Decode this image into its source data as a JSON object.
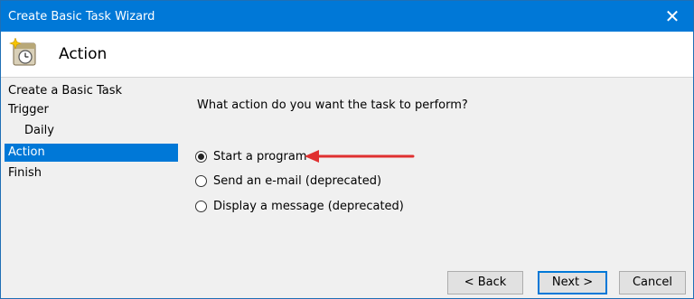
{
  "window": {
    "title": "Create Basic Task Wizard",
    "close_glyph": "✕"
  },
  "header": {
    "title": "Action",
    "icon": "clock-task-icon"
  },
  "sidebar": {
    "items": [
      {
        "label": "Create a Basic Task"
      },
      {
        "label": "Trigger"
      },
      {
        "label": "Daily"
      },
      {
        "label": "Action",
        "selected": true
      },
      {
        "label": "Finish"
      }
    ]
  },
  "main": {
    "question": "What action do you want the task to perform?",
    "options": [
      {
        "label": "Start a program",
        "selected": true
      },
      {
        "label": "Send an e-mail (deprecated)",
        "selected": false
      },
      {
        "label": "Display a message (deprecated)",
        "selected": false
      }
    ],
    "arrow_color": "#e03030"
  },
  "buttons": {
    "back": "< Back",
    "next": "Next >",
    "cancel": "Cancel"
  }
}
